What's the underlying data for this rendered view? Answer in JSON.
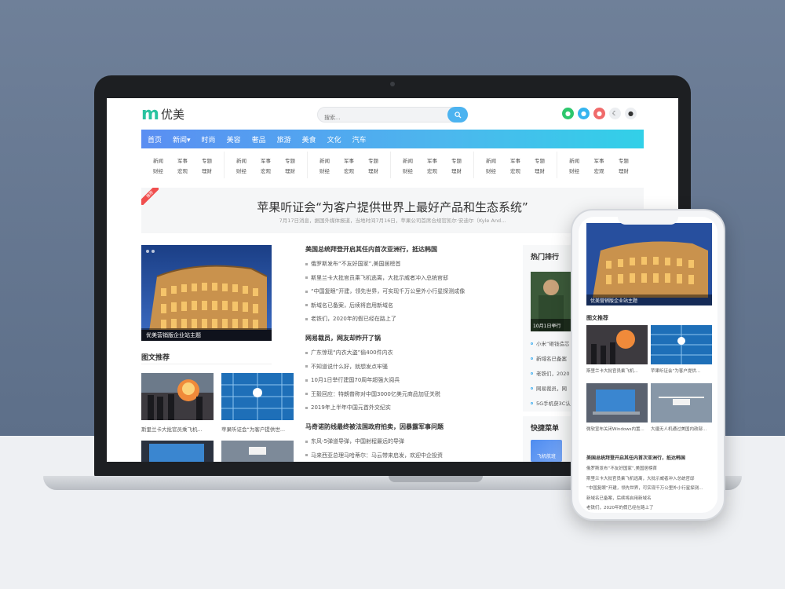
{
  "site": {
    "logo_mark": "m",
    "logo_text": "优美",
    "search_placeholder": "搜索...",
    "search_icon": "search-icon",
    "social_icons": [
      "wechat-icon",
      "qq-icon",
      "weibo-icon",
      "moon-icon",
      "user-icon"
    ],
    "colors": {
      "accent": "#4cb3f0",
      "nav_start": "#5a8ef2",
      "nav_end": "#32d0e8",
      "logo": "#29c3a0",
      "hot": "#f04e4e"
    }
  },
  "nav": {
    "items": [
      "首页",
      "新闻▾",
      "时尚",
      "美容",
      "奢品",
      "旅游",
      "美食",
      "文化",
      "汽车"
    ]
  },
  "subnav": {
    "groups": [
      [
        "新闻",
        "军事",
        "专题",
        "财经",
        "宏观",
        "理财"
      ],
      [
        "新闻",
        "军事",
        "专题",
        "财经",
        "宏观",
        "理财"
      ],
      [
        "新闻",
        "军事",
        "专题",
        "财经",
        "宏观",
        "理财"
      ],
      [
        "新闻",
        "军事",
        "专题",
        "财经",
        "宏观",
        "理财"
      ],
      [
        "新闻",
        "军事",
        "专题",
        "财经",
        "宏观",
        "理财"
      ],
      [
        "新闻",
        "军事",
        "专题",
        "财经",
        "宏观",
        "理财"
      ]
    ]
  },
  "headline": {
    "tag": "推荐",
    "title": "苹果听证会“为客户提供世界上最好产品和生态系统”",
    "subtitle": "7月17日消息，据国外媒体报道，当地时间7月16日，苹果公司首席合规官凯尔·安迪尔（Kyle And..."
  },
  "feature": {
    "caption": "优美营销版企业站主题"
  },
  "picture_section": {
    "title": "图文推荐",
    "items": [
      {
        "caption": "斯里兰卡大批官员乘飞机..."
      },
      {
        "caption": "苹果听证会“为客户提供世..."
      },
      {
        "caption": ""
      },
      {
        "caption": ""
      }
    ]
  },
  "news": {
    "groups": [
      {
        "lead": "美国总统拜登开启其任内首次亚洲行，抵达韩国",
        "items": [
          "俄罗斯发布“不友好国家”,美国居榜首",
          "斯里兰卡大批官员乘飞机逃离，大批示威者冲入总统官邸",
          "“中国复眼”开建，领先世界，可实现千万公里外小行星探测成像",
          "新域名已备案，后续将启用新域名",
          "老铁们，2020年的假已经在路上了"
        ]
      },
      {
        "lead": "网易裁员，网友却炸开了锅",
        "items": [
          "广东惊现“内衣大盗”偷400件内衣",
          "不知道说什么好，就想发点牢骚",
          "10月1日举行建国70周年超强大阅兵",
          "王毅回应：特朗普称对中国3000亿美元商品加征关税",
          "2019年上半年中国元首外交纪实"
        ]
      },
      {
        "lead": "马奇诺防线最终被法国政府拍卖，因暴露军事问题",
        "items": [
          "东风-5弹道导弹，中国射程最远的导弹",
          "马来西亚总理马哈蒂尔：马云带来启发，欢迎中企投资"
        ]
      }
    ]
  },
  "sidebar": {
    "hot_title": "热门排行",
    "image_caption": "10月1日举行",
    "hot_items": [
      "小米“砸钱造芯",
      "新域名已备案",
      "老铁们，2020",
      "网易裁员，网",
      "5G手机获3C认"
    ],
    "quick_title": "快捷菜单",
    "quick_btn": "飞机航班"
  },
  "phone": {
    "feature_caption": "优美营销版企业站主题",
    "section_title": "图文推荐",
    "thumbs": [
      "斯里兰卡大批官员乘飞机...",
      "苹果听证会“为客户提供...",
      "微软宣布关闭Windows内置...",
      "大疆无人机通过美国内政部..."
    ],
    "lead": "美国总统拜登开启其任内首次亚洲行，抵达韩国",
    "items": [
      "俄罗斯发布“不友好国家”,美国居榜首",
      "斯里兰卡大批官员乘飞机逃离，大批示威者冲入总统官邸",
      "“中国复眼”开建，领先世界，可实现千万公里外小行星探测...",
      "新域名已备案，后续将启用新域名",
      "老铁们，2020年的假已经在路上了"
    ]
  }
}
